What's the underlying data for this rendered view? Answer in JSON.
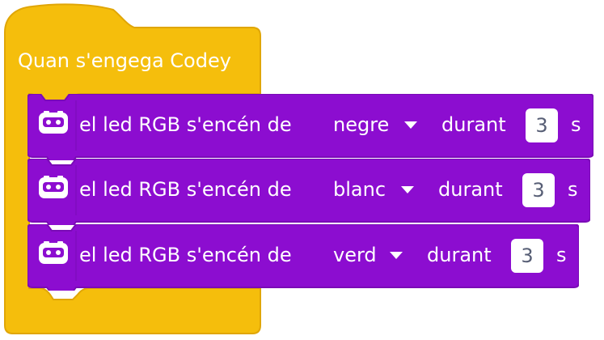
{
  "hat_block": {
    "label": "Quan s'engega Codey",
    "color": "#f5be0c",
    "border_color": "#e0a607"
  },
  "blocks": [
    {
      "prefix": "el led RGB s'encén de",
      "color_option": "negre",
      "during_label": "durant",
      "duration": "3",
      "unit": "s"
    },
    {
      "prefix": "el led RGB s'encén de",
      "color_option": "blanc",
      "during_label": "durant",
      "duration": "3",
      "unit": "s"
    },
    {
      "prefix": "el led RGB s'encén de",
      "color_option": "verd",
      "during_label": "durant",
      "duration": "3",
      "unit": "s"
    }
  ],
  "colors": {
    "block_fill": "#8c0dd0",
    "block_border": "#7a0bb6",
    "icon": "robot-face-icon"
  }
}
